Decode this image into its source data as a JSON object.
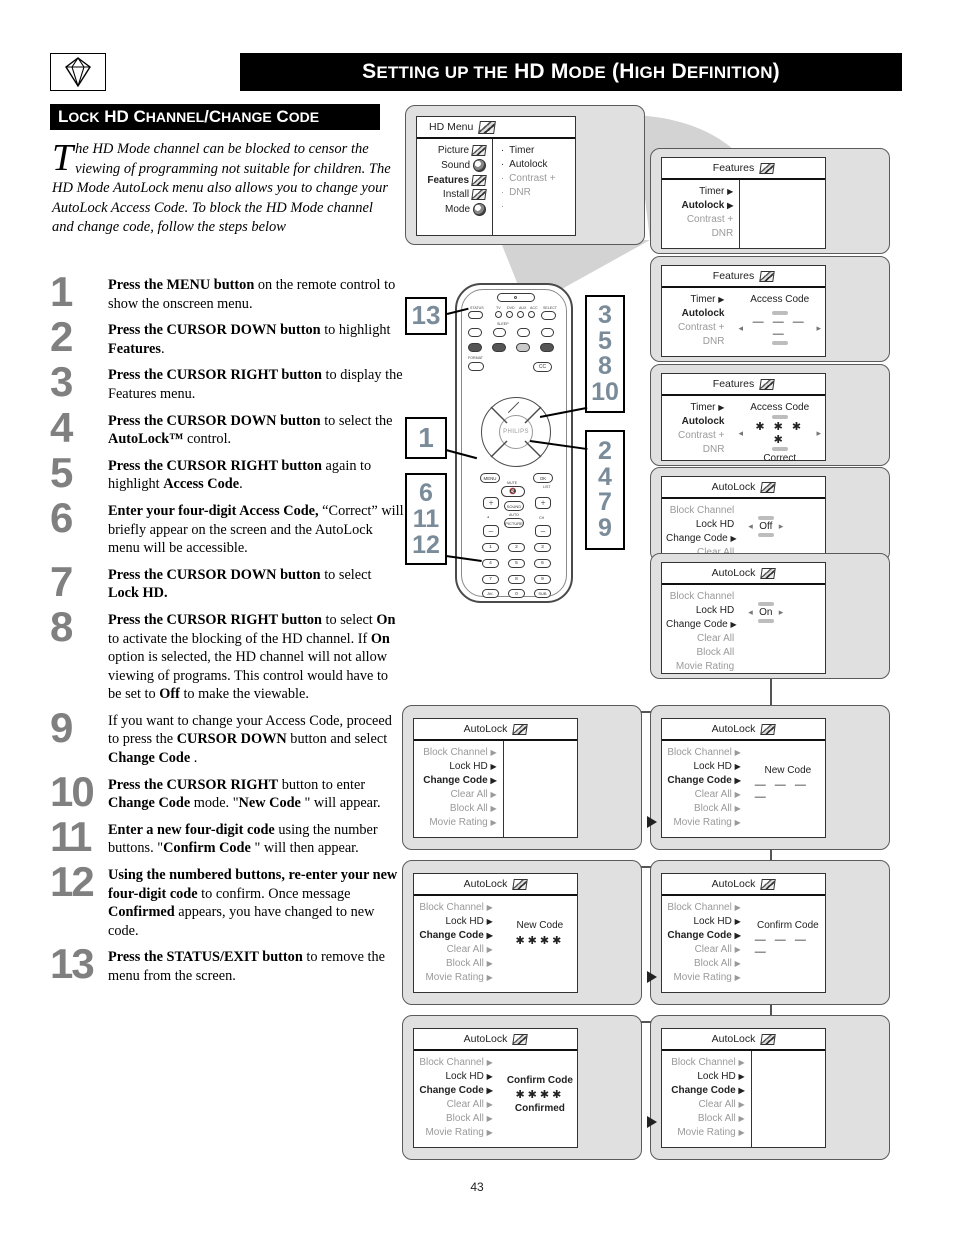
{
  "header": {
    "title_parts": [
      "S",
      "ETTING UP THE ",
      "HD M",
      "ODE ",
      "(H",
      "IGH ",
      "D",
      "EFINITION",
      ")"
    ],
    "title": "SETTING UP THE HD MODE (HIGH DEFINITION)",
    "logo_icon": "diamond-gem-icon"
  },
  "section": {
    "title": "LOCK HD CHANNEL/CHANGE CODE"
  },
  "intro": {
    "dropcap": "T",
    "text": "he HD Mode channel can be blocked to censor the viewing of programming not suitable for children. The HD Mode AutoLock menu also allows you to change your AutoLock Access Code. To block the HD Mode channel and change code, follow the steps below"
  },
  "steps": [
    {
      "num": "1",
      "html": "<b>Press the MENU button</b> on the remote control to show the onscreen menu."
    },
    {
      "num": "2",
      "html": "<b>Press the CURSOR DOWN button</b> to highlight <b>Features</b>."
    },
    {
      "num": "3",
      "html": "<b>Press the CURSOR RIGHT button</b> to display the Features menu."
    },
    {
      "num": "4",
      "html": "<b>Press the CURSOR DOWN button</b> to select the <b>AutoLock&trade;</b> control."
    },
    {
      "num": "5",
      "html": "<b>Press the CURSOR RIGHT button</b> again to highlight <b>Access Code</b>."
    },
    {
      "num": "6",
      "html": "<b>Enter your four-digit Access Code,</b> &ldquo;Correct&rdquo; will briefly appear on the screen and the AutoLock menu will be accessible."
    },
    {
      "num": "7",
      "html": "<b>Press the CURSOR DOWN button</b> to select <b>Lock HD.</b>"
    },
    {
      "num": "8",
      "html": "<b>Press the CURSOR RIGHT button</b> to select <b>On</b> to activate the blocking of the HD channel.  If <b>On</b> option is selected, the HD channel will not allow viewing of programs. This control would have to be set to <b>Off</b> to make the viewable."
    },
    {
      "num": "9",
      "html": "If you want to change your Access Code, proceed to press the <b>CURSOR DOWN</b> button and select <b>Change Code</b> ."
    },
    {
      "num": "10",
      "html": "<b>Press the CURSOR RIGHT</b> button to enter <b>Change Code</b> mode. \"<b>New Code </b>\" will appear."
    },
    {
      "num": "11",
      "html": "<b>Enter a new four-digit code</b> using the number buttons. \"<b>Confirm Code </b>\" will then appear."
    },
    {
      "num": "12",
      "html": "<b>Using the numbered buttons, re-enter your new four-digit code</b> to confirm. Once message <b>Confirmed</b> appears, you have changed to new code."
    },
    {
      "num": "13",
      "html": "<b>Press the STATUS/EXIT button</b> to remove the menu from the screen."
    }
  ],
  "osd": {
    "hd_menu": {
      "title": "HD Menu",
      "icon": "menu-tile-icon",
      "left_items": [
        {
          "label": "Picture",
          "bold": false,
          "icon": "picture-icon"
        },
        {
          "label": "Sound",
          "bold": false,
          "icon": "sound-icon"
        },
        {
          "label": "Features",
          "bold": true,
          "icon": "features-icon"
        },
        {
          "label": "Install",
          "bold": false,
          "icon": "install-icon"
        },
        {
          "label": "Mode",
          "bold": false,
          "icon": "mode-icon"
        }
      ],
      "right_items": [
        {
          "label": "Timer",
          "gray": false
        },
        {
          "label": "Autolock",
          "gray": false
        },
        {
          "label": "Contrast +",
          "gray": true
        },
        {
          "label": "DNR",
          "gray": true
        }
      ]
    },
    "features_1": {
      "title": "Features",
      "items": [
        {
          "label": "Timer",
          "bold": false,
          "gray": false,
          "caret": true
        },
        {
          "label": "Autolock",
          "bold": true,
          "gray": false,
          "caret": true
        },
        {
          "label": "Contrast +",
          "bold": false,
          "gray": true,
          "caret": false
        },
        {
          "label": "DNR",
          "bold": false,
          "gray": true,
          "caret": false
        }
      ],
      "value_label": "",
      "value": ""
    },
    "features_2": {
      "title": "Features",
      "items": [
        {
          "label": "Timer",
          "bold": false,
          "gray": false,
          "caret": true
        },
        {
          "label": "Autolock",
          "bold": true,
          "gray": false,
          "caret": false
        },
        {
          "label": "Contrast +",
          "bold": false,
          "gray": true,
          "caret": false
        },
        {
          "label": "DNR",
          "bold": false,
          "gray": true,
          "caret": false
        }
      ],
      "value_label": "Access Code",
      "value": "— — — —",
      "status": ""
    },
    "features_3": {
      "title": "Features",
      "items": [
        {
          "label": "Timer",
          "bold": false,
          "gray": false,
          "caret": true
        },
        {
          "label": "Autolock",
          "bold": true,
          "gray": false,
          "caret": false
        },
        {
          "label": "Contrast +",
          "bold": false,
          "gray": true,
          "caret": false
        },
        {
          "label": "DNR",
          "bold": false,
          "gray": true,
          "caret": false
        }
      ],
      "value_label": "Access Code",
      "value": "✱ ✱ ✱ ✱",
      "status": "Correct"
    },
    "autolock_off": {
      "title": "AutoLock",
      "items": [
        {
          "label": "Block Channel",
          "bold": false,
          "gray": true,
          "caret": false
        },
        {
          "label": "Lock HD",
          "bold": false,
          "gray": false,
          "caret": false
        },
        {
          "label": "Change Code",
          "bold": false,
          "gray": false,
          "caret": true
        },
        {
          "label": "Clear All",
          "bold": false,
          "gray": true,
          "caret": false
        }
      ],
      "value": "Off"
    },
    "autolock_on": {
      "title": "AutoLock",
      "items": [
        {
          "label": "Block Channel",
          "bold": false,
          "gray": true,
          "caret": false
        },
        {
          "label": "Lock HD",
          "bold": false,
          "gray": false,
          "caret": false
        },
        {
          "label": "Change Code",
          "bold": false,
          "gray": false,
          "caret": true
        },
        {
          "label": "Clear All",
          "bold": false,
          "gray": true,
          "caret": false
        },
        {
          "label": "Block All",
          "bold": false,
          "gray": true,
          "caret": false
        },
        {
          "label": "Movie Rating",
          "bold": false,
          "gray": true,
          "caret": false
        }
      ],
      "value": "On"
    },
    "autolock_changecode": {
      "title": "AutoLock",
      "items": [
        {
          "label": "Block Channel",
          "bold": false,
          "gray": true,
          "caret": true
        },
        {
          "label": "Lock HD",
          "bold": false,
          "gray": false,
          "caret": true
        },
        {
          "label": "Change Code",
          "bold": true,
          "gray": false,
          "caret": true
        },
        {
          "label": "Clear All",
          "bold": false,
          "gray": true,
          "caret": true
        },
        {
          "label": "Block All",
          "bold": false,
          "gray": true,
          "caret": true
        },
        {
          "label": "Movie Rating",
          "bold": false,
          "gray": true,
          "caret": true
        }
      ],
      "value_label": "",
      "value": ""
    },
    "autolock_newcode_dashes": {
      "title": "AutoLock",
      "items": [
        {
          "label": "Block Channel",
          "bold": false,
          "gray": true,
          "caret": true
        },
        {
          "label": "Lock HD",
          "bold": false,
          "gray": false,
          "caret": true
        },
        {
          "label": "Change Code",
          "bold": true,
          "gray": false,
          "caret": true
        },
        {
          "label": "Clear All",
          "bold": false,
          "gray": true,
          "caret": true
        },
        {
          "label": "Block All",
          "bold": false,
          "gray": true,
          "caret": true
        },
        {
          "label": "Movie Rating",
          "bold": false,
          "gray": true,
          "caret": true
        }
      ],
      "value_label": "New Code",
      "value": "— — — —",
      "status": ""
    },
    "autolock_newcode_stars": {
      "title": "AutoLock",
      "items": [
        {
          "label": "Block Channel",
          "bold": false,
          "gray": true,
          "caret": true
        },
        {
          "label": "Lock HD",
          "bold": false,
          "gray": false,
          "caret": true
        },
        {
          "label": "Change Code",
          "bold": true,
          "gray": false,
          "caret": true
        },
        {
          "label": "Clear All",
          "bold": false,
          "gray": true,
          "caret": true
        },
        {
          "label": "Block All",
          "bold": false,
          "gray": true,
          "caret": true
        },
        {
          "label": "Movie Rating",
          "bold": false,
          "gray": true,
          "caret": true
        }
      ],
      "value_label": "New Code",
      "value": "✱✱✱✱",
      "status": ""
    },
    "autolock_confirmcode_dashes": {
      "title": "AutoLock",
      "items": [
        {
          "label": "Block Channel",
          "bold": false,
          "gray": true,
          "caret": true
        },
        {
          "label": "Lock HD",
          "bold": false,
          "gray": false,
          "caret": true
        },
        {
          "label": "Change Code",
          "bold": true,
          "gray": false,
          "caret": true
        },
        {
          "label": "Clear All",
          "bold": false,
          "gray": true,
          "caret": true
        },
        {
          "label": "Block All",
          "bold": false,
          "gray": true,
          "caret": true
        },
        {
          "label": "Movie Rating",
          "bold": false,
          "gray": true,
          "caret": true
        }
      ],
      "value_label": "Confirm Code",
      "value": "— — — —",
      "status": ""
    },
    "autolock_confirmed": {
      "title": "AutoLock",
      "items": [
        {
          "label": "Block Channel",
          "bold": false,
          "gray": true,
          "caret": true
        },
        {
          "label": "Lock HD",
          "bold": false,
          "gray": false,
          "caret": true
        },
        {
          "label": "Change Code",
          "bold": true,
          "gray": false,
          "caret": true
        },
        {
          "label": "Clear All",
          "bold": false,
          "gray": true,
          "caret": true
        },
        {
          "label": "Block All",
          "bold": false,
          "gray": true,
          "caret": true
        },
        {
          "label": "Movie Rating",
          "bold": false,
          "gray": true,
          "caret": true
        }
      ],
      "value_label": "Confirm Code",
      "value": "✱✱✱✱",
      "status": "Confirmed"
    },
    "autolock_final": {
      "title": "AutoLock",
      "items": [
        {
          "label": "Block Channel",
          "bold": false,
          "gray": true,
          "caret": true
        },
        {
          "label": "Lock HD",
          "bold": false,
          "gray": false,
          "caret": true
        },
        {
          "label": "Change Code",
          "bold": true,
          "gray": false,
          "caret": true
        },
        {
          "label": "Clear All",
          "bold": false,
          "gray": true,
          "caret": true
        },
        {
          "label": "Block All",
          "bold": false,
          "gray": true,
          "caret": true
        },
        {
          "label": "Movie Rating",
          "bold": false,
          "gray": true,
          "caret": true
        }
      ],
      "value_label": "",
      "value": ""
    }
  },
  "remote": {
    "brand": "PHILIPS",
    "callouts": {
      "status_exit": [
        "13"
      ],
      "cursor_right": [
        "3",
        "5",
        "8",
        "10"
      ],
      "menu": [
        "1"
      ],
      "cursor_down": [
        "2",
        "4",
        "7",
        "9"
      ],
      "numbers": [
        "6",
        "11",
        "12"
      ]
    },
    "labels": {
      "status": "STATUS",
      "select": "SELECT",
      "sleep": "SLEEP",
      "format": "FORMAT",
      "menu": "MENU",
      "mute": "MUTE",
      "ok": "OK",
      "list": "LIST",
      "ch": "CH",
      "sound": "SOUND",
      "auto": "AUTO",
      "picture": "PICTURE",
      "cc": "CC",
      "tv": "TV",
      "dvd": "DVD",
      "aux": "AUX",
      "acc": "ACC",
      "av": "AV-",
      "sub": "SUB"
    },
    "number_keys": [
      "1",
      "2",
      "3",
      "4",
      "5",
      "6",
      "7",
      "8",
      "9",
      "0"
    ]
  },
  "colors": {
    "callout_number": "#7a8b99",
    "step_number": "#808080",
    "header_bar": "#000000",
    "panel_bg": "#e0e0e0",
    "gray_text": "#9a9a9a"
  },
  "footer": {
    "page_number": "43"
  }
}
